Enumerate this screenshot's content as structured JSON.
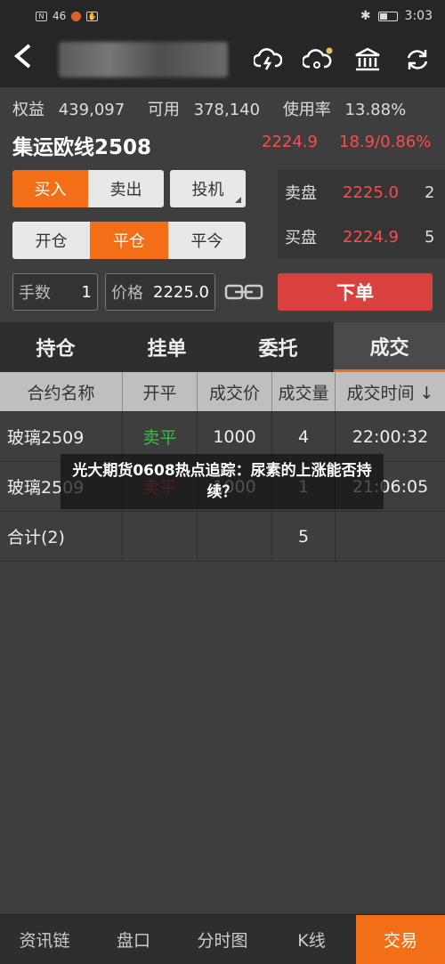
{
  "status_bar": {
    "time": "3:03",
    "network": "46",
    "speed": "↑↓"
  },
  "nav": {
    "back_glyph": "<"
  },
  "account": {
    "equity_label": "权益",
    "equity": "439,097",
    "available_label": "可用",
    "available": "378,140",
    "usage_label": "使用率",
    "usage": "13.88%"
  },
  "contract": {
    "name": "集运欧线2508",
    "price": "2224.9",
    "change": "18.9/0.86%"
  },
  "direction": {
    "buy": "买入",
    "sell": "卖出"
  },
  "speculation": "投机",
  "offset": {
    "open": "开仓",
    "close": "平仓",
    "close_today": "平今"
  },
  "book": {
    "ask_label": "卖盘",
    "ask_price": "2225.0",
    "ask_qty": "2",
    "bid_label": "买盘",
    "bid_price": "2224.9",
    "bid_qty": "5"
  },
  "quantity": {
    "label": "手数",
    "value": "1"
  },
  "price_input": {
    "label": "价格",
    "value": "2225.0"
  },
  "order_button": "下单",
  "tabs": [
    "持仓",
    "挂单",
    "委托",
    "成交"
  ],
  "table": {
    "headers": [
      "合约名称",
      "开平",
      "成交价",
      "成交量",
      "成交时间 ↓"
    ],
    "rows": [
      [
        "玻璃2509",
        "卖平",
        "1000",
        "4",
        "22:00:32"
      ],
      [
        "玻璃2509",
        "卖平",
        "1000",
        "1",
        "21:06:05"
      ]
    ],
    "total": {
      "label": "合计(2)",
      "volume": "5"
    }
  },
  "overlay_title": "光大期货0608热点追踪：尿素的上涨能否持续？",
  "bottom_nav": [
    "资讯链",
    "盘口",
    "分时图",
    "K线",
    "交易"
  ],
  "colors": {
    "accent": "#f36f17",
    "up": "#ff4a4a",
    "sell_close": "#3fb84a",
    "order": "#d9413f"
  }
}
